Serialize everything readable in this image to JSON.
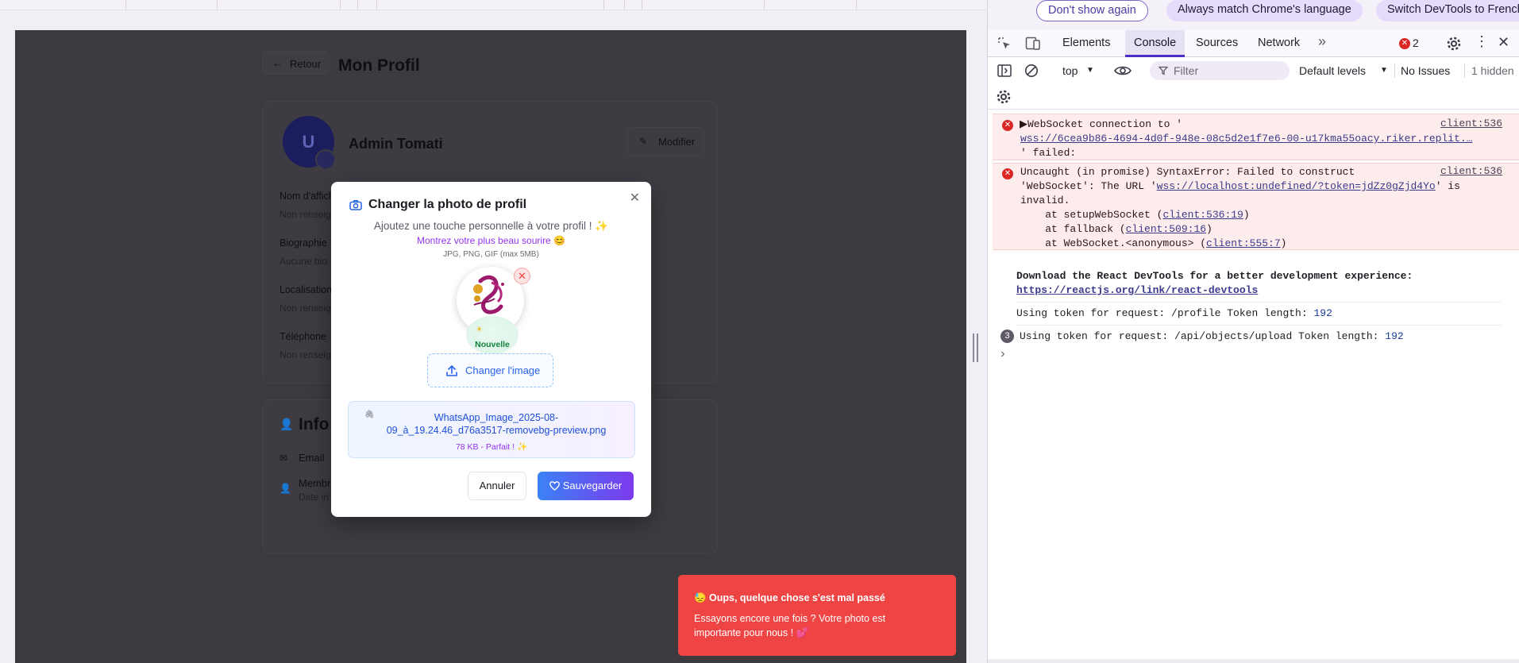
{
  "page": {
    "back_label": "Retour",
    "title": "Mon Profil",
    "avatar_initial": "U",
    "user_name": "Admin Tomati",
    "edit_label": "Modifier",
    "fields": [
      {
        "label": "Nom d'affich",
        "value": "Non renseig"
      },
      {
        "label": "Biographie",
        "value": "Aucune bio"
      },
      {
        "label": "Localisation",
        "value": "Non renseig"
      },
      {
        "label": "Téléphone",
        "value": "Non renseig"
      }
    ],
    "info_title": "Info",
    "email_label": "Email",
    "member_label": "Membr",
    "member_value": "Date in"
  },
  "modal": {
    "title": "Changer la photo de profil",
    "subtitle": "Ajoutez une touche personnelle à votre profil ! ✨",
    "tagline": "Montrez votre plus beau sourire 😊",
    "formats": "JPG, PNG, GIF (max 5MB)",
    "new_badge": "Nouvelle",
    "change_image": "Changer l'image",
    "file_name": "WhatsApp_Image_2025-08-09_à_19.24.46_d76a3517-removebg-preview.png",
    "file_size": "78 KB - Parfait ! ✨",
    "cancel": "Annuler",
    "save": "Sauvegarder"
  },
  "toast": {
    "title": "😓 Oups, quelque chose s'est mal passé",
    "message": "Essayons encore une fois ? Votre photo est importante pour nous ! 💕"
  },
  "devtools": {
    "lang_bar": {
      "dont_show": "Don't show again",
      "always_match": "Always match Chrome's language",
      "switch": "Switch DevTools to French"
    },
    "tabs": [
      "Elements",
      "Console",
      "Sources",
      "Network"
    ],
    "active_tab": "Console",
    "error_count": "2",
    "context": "top",
    "filter_placeholder": "Filter",
    "levels": "Default levels",
    "issues": "No Issues",
    "hidden": "1 hidden",
    "errors": [
      {
        "lines": [
          "▶WebSocket connection to '",
          "wss://6cea9b86-4694-4d0f-948e-08c5d2e1f7e6-00-u17kma55oacy.riker.replit.…",
          "' failed:"
        ],
        "source": "client:536"
      },
      {
        "l1": "Uncaught (in promise) SyntaxError: Failed to construct",
        "l2a": "'WebSocket': The URL '",
        "l2url": "wss://localhost:undefined/?token=jdZz0gZjd4Yo",
        "l2b": "' is",
        "l3": "invalid.",
        "stack": [
          {
            "pre": "    at setupWebSocket (",
            "link": "client:536:19",
            "post": ")"
          },
          {
            "pre": "    at fallback (",
            "link": "client:509:16",
            "post": ")"
          },
          {
            "pre": "    at WebSocket.<anonymous> (",
            "link": "client:555:7",
            "post": ")"
          }
        ],
        "source": "client:536"
      }
    ],
    "react_msg": "Download the React DevTools for a better development experience:",
    "react_link": "https://reactjs.org/link/react-devtools",
    "log1_text": "Using token for request: /profile Token length: ",
    "log1_num": "192",
    "log2_count": "3",
    "log2_text": "Using token for request: /api/objects/upload Token length: ",
    "log2_num": "192",
    "prompt": "›"
  },
  "colors": {
    "accent": "#4b2fc4",
    "error_bg": "#fceceb",
    "toast": "#ef4444",
    "save_gradient_start": "#3b82f6",
    "save_gradient_end": "#7c3aed"
  }
}
